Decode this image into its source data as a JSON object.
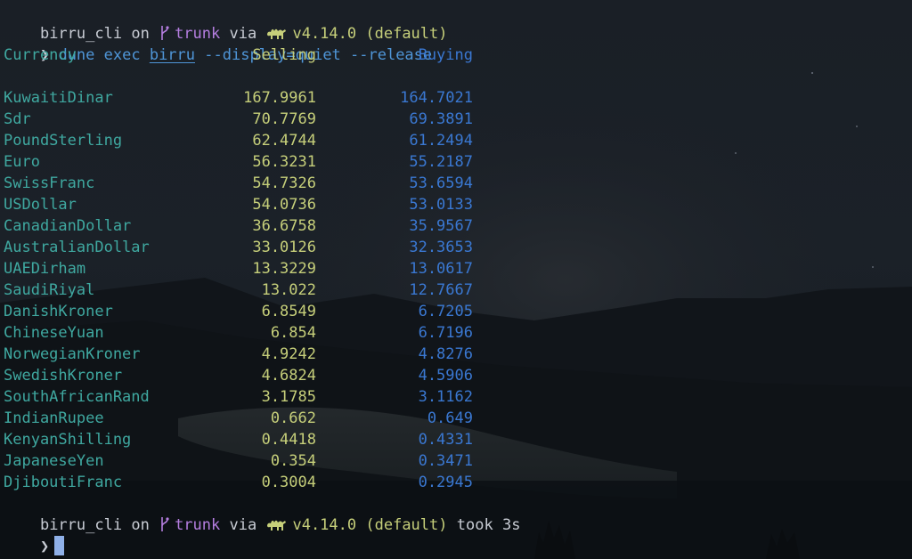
{
  "prompt1": {
    "dir": "birru_cli",
    "on": "on",
    "branch": "trunk",
    "via": "via",
    "version": "v4.14.0",
    "switch": "(default)",
    "icons": [
      "git-branch-icon",
      "ocaml-camel-icon"
    ]
  },
  "command": {
    "arrow": "❯",
    "prefix": "dune exec",
    "exe": "birru",
    "args": "--display=quiet --release"
  },
  "table": {
    "headers": {
      "currency": "Currency",
      "selling": "Selling",
      "buying": "Buying"
    },
    "rows": [
      {
        "currency": "KuwaitiDinar",
        "selling": "167.9961",
        "buying": "164.7021"
      },
      {
        "currency": "Sdr",
        "selling": "70.7769",
        "buying": "69.3891"
      },
      {
        "currency": "PoundSterling",
        "selling": "62.4744",
        "buying": "61.2494"
      },
      {
        "currency": "Euro",
        "selling": "56.3231",
        "buying": "55.2187"
      },
      {
        "currency": "SwissFranc",
        "selling": "54.7326",
        "buying": "53.6594"
      },
      {
        "currency": "USDollar",
        "selling": "54.0736",
        "buying": "53.0133"
      },
      {
        "currency": "CanadianDollar",
        "selling": "36.6758",
        "buying": "35.9567"
      },
      {
        "currency": "AustralianDollar",
        "selling": "33.0126",
        "buying": "32.3653"
      },
      {
        "currency": "UAEDirham",
        "selling": "13.3229",
        "buying": "13.0617"
      },
      {
        "currency": "SaudiRiyal",
        "selling": "13.022",
        "buying": "12.7667"
      },
      {
        "currency": "DanishKroner",
        "selling": "6.8549",
        "buying": "6.7205"
      },
      {
        "currency": "ChineseYuan",
        "selling": "6.854",
        "buying": "6.7196"
      },
      {
        "currency": "NorwegianKroner",
        "selling": "4.9242",
        "buying": "4.8276"
      },
      {
        "currency": "SwedishKroner",
        "selling": "4.6824",
        "buying": "4.5906"
      },
      {
        "currency": "SouthAfricanRand",
        "selling": "3.1785",
        "buying": "3.1162"
      },
      {
        "currency": "IndianRupee",
        "selling": "0.662",
        "buying": "0.649"
      },
      {
        "currency": "KenyanShilling",
        "selling": "0.4418",
        "buying": "0.4331"
      },
      {
        "currency": "JapaneseYen",
        "selling": "0.354",
        "buying": "0.3471"
      },
      {
        "currency": "DjiboutiFranc",
        "selling": "0.3004",
        "buying": "0.2945"
      }
    ]
  },
  "prompt2": {
    "dir": "birru_cli",
    "on": "on",
    "branch": "trunk",
    "via": "via",
    "version": "v4.14.0",
    "switch": "(default)",
    "took": "took",
    "duration": "3s"
  },
  "input": {
    "arrow": "❯",
    "value": ""
  },
  "colors": {
    "text": "#c8ccd4",
    "branch": "#b57ee0",
    "ocaml": "#c6cf7a",
    "command": "#4f96d8",
    "currency": "#3fa8a0",
    "selling": "#c6cf7a",
    "buying": "#3a78d2",
    "cursor": "#8fb0e8"
  }
}
